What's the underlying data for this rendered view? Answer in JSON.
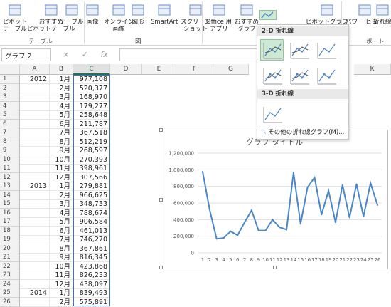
{
  "ribbon": {
    "buttons": [
      {
        "name": "pivot-table-button",
        "label": "ピボット\nテーブル"
      },
      {
        "name": "recommended-pivot-button",
        "label": "おすすめ\nピボットテーブル"
      },
      {
        "name": "table-button",
        "label": "テーブル"
      },
      {
        "name": "picture-button",
        "label": "画像"
      },
      {
        "name": "online-picture-button",
        "label": "オンライン\n画像"
      },
      {
        "name": "shapes-button",
        "label": "図形"
      },
      {
        "name": "smartart-button",
        "label": "SmartArt"
      },
      {
        "name": "screenshot-button",
        "label": "スクリーン\nショット"
      },
      {
        "name": "office-apps-button",
        "label": "Office 用\nアプリ"
      },
      {
        "name": "recommended-chart-button",
        "label": "おすすめ\nグラフ"
      },
      {
        "name": "pivot-chart-button",
        "label": "ピボットグラフ"
      },
      {
        "name": "power-view-button",
        "label": "パワー ビュー"
      },
      {
        "name": "sparkline-line-button",
        "label": "折れ線"
      }
    ],
    "groups": {
      "tables": "テーブル",
      "illustrations_dialog": "図",
      "report": "ポート"
    }
  },
  "formula_bar": {
    "name_box": "グラフ 2",
    "cancel": "×",
    "enter": "✓",
    "fx": "fx"
  },
  "columns": [
    "A",
    "B",
    "C",
    "D",
    "E",
    "F",
    "G",
    "K"
  ],
  "rows": [
    {
      "n": "1",
      "a": "2012",
      "b": "1月",
      "c": "977,108"
    },
    {
      "n": "2",
      "a": "",
      "b": "2月",
      "c": "520,377"
    },
    {
      "n": "3",
      "a": "",
      "b": "3月",
      "c": "168,970"
    },
    {
      "n": "4",
      "a": "",
      "b": "4月",
      "c": "179,277"
    },
    {
      "n": "5",
      "a": "",
      "b": "5月",
      "c": "258,648"
    },
    {
      "n": "6",
      "a": "",
      "b": "6月",
      "c": "211,787"
    },
    {
      "n": "7",
      "a": "",
      "b": "7月",
      "c": "367,518"
    },
    {
      "n": "8",
      "a": "",
      "b": "8月",
      "c": "512,219"
    },
    {
      "n": "9",
      "a": "",
      "b": "9月",
      "c": "268,597"
    },
    {
      "n": "10",
      "a": "",
      "b": "10月",
      "c": "270,393"
    },
    {
      "n": "11",
      "a": "",
      "b": "11月",
      "c": "398,961"
    },
    {
      "n": "12",
      "a": "",
      "b": "12月",
      "c": "307,566"
    },
    {
      "n": "13",
      "a": "2013",
      "b": "1月",
      "c": "279,881"
    },
    {
      "n": "14",
      "a": "",
      "b": "2月",
      "c": "966,625"
    },
    {
      "n": "15",
      "a": "",
      "b": "3月",
      "c": "348,733"
    },
    {
      "n": "16",
      "a": "",
      "b": "4月",
      "c": "788,674"
    },
    {
      "n": "17",
      "a": "",
      "b": "5月",
      "c": "906,584"
    },
    {
      "n": "18",
      "a": "",
      "b": "6月",
      "c": "461,013"
    },
    {
      "n": "19",
      "a": "",
      "b": "7月",
      "c": "746,270"
    },
    {
      "n": "20",
      "a": "",
      "b": "8月",
      "c": "367,861"
    },
    {
      "n": "21",
      "a": "",
      "b": "9月",
      "c": "816,345"
    },
    {
      "n": "22",
      "a": "",
      "b": "10月",
      "c": "423,868"
    },
    {
      "n": "23",
      "a": "",
      "b": "11月",
      "c": "826,233"
    },
    {
      "n": "24",
      "a": "",
      "b": "12月",
      "c": "438,097"
    },
    {
      "n": "25",
      "a": "2014",
      "b": "1月",
      "c": "839,493"
    },
    {
      "n": "26",
      "a": "",
      "b": "2月",
      "c": "575,891"
    }
  ],
  "dropdown": {
    "section_2d": "2-D 折れ線",
    "section_3d": "3-D 折れ線",
    "more_link": "その他の折れ線グラフ(M)..."
  },
  "chart_data": {
    "type": "line",
    "title": "グラフ タイトル",
    "x": [
      1,
      2,
      3,
      4,
      5,
      6,
      7,
      8,
      9,
      10,
      11,
      12,
      13,
      14,
      15,
      16,
      17,
      18,
      19,
      20,
      21,
      22,
      23,
      24,
      25,
      26
    ],
    "series": [
      {
        "values": [
          977108,
          520377,
          168970,
          179277,
          258648,
          211787,
          367518,
          512219,
          268597,
          270393,
          398961,
          307566,
          279881,
          966625,
          348733,
          788674,
          906584,
          461013,
          746270,
          367861,
          816345,
          423868,
          826233,
          438097,
          839493,
          575891
        ]
      }
    ],
    "ylim": [
      0,
      1200000
    ],
    "yticks": [
      "0",
      "200,000",
      "400,000",
      "600,000",
      "800,000",
      "1,000,000",
      "1,200,000"
    ],
    "grid": true,
    "color": "#4a86c8"
  }
}
